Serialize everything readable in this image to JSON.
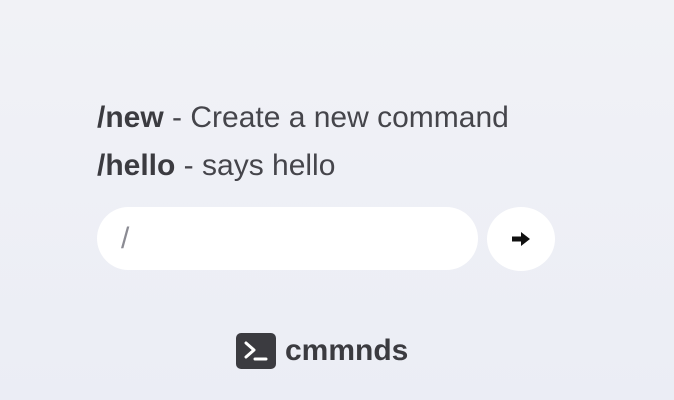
{
  "commands": [
    {
      "name": "/new",
      "description": " - Create a new command"
    },
    {
      "name": "/hello",
      "description": " - says hello"
    }
  ],
  "input": {
    "value": "/",
    "placeholder": ""
  },
  "submit": {
    "icon": "arrow-right-icon"
  },
  "brand": {
    "name": "cmmnds",
    "icon": "terminal-icon"
  },
  "colors": {
    "background": "#eef0f5",
    "text": "#3b3b40",
    "surface": "#ffffff"
  }
}
